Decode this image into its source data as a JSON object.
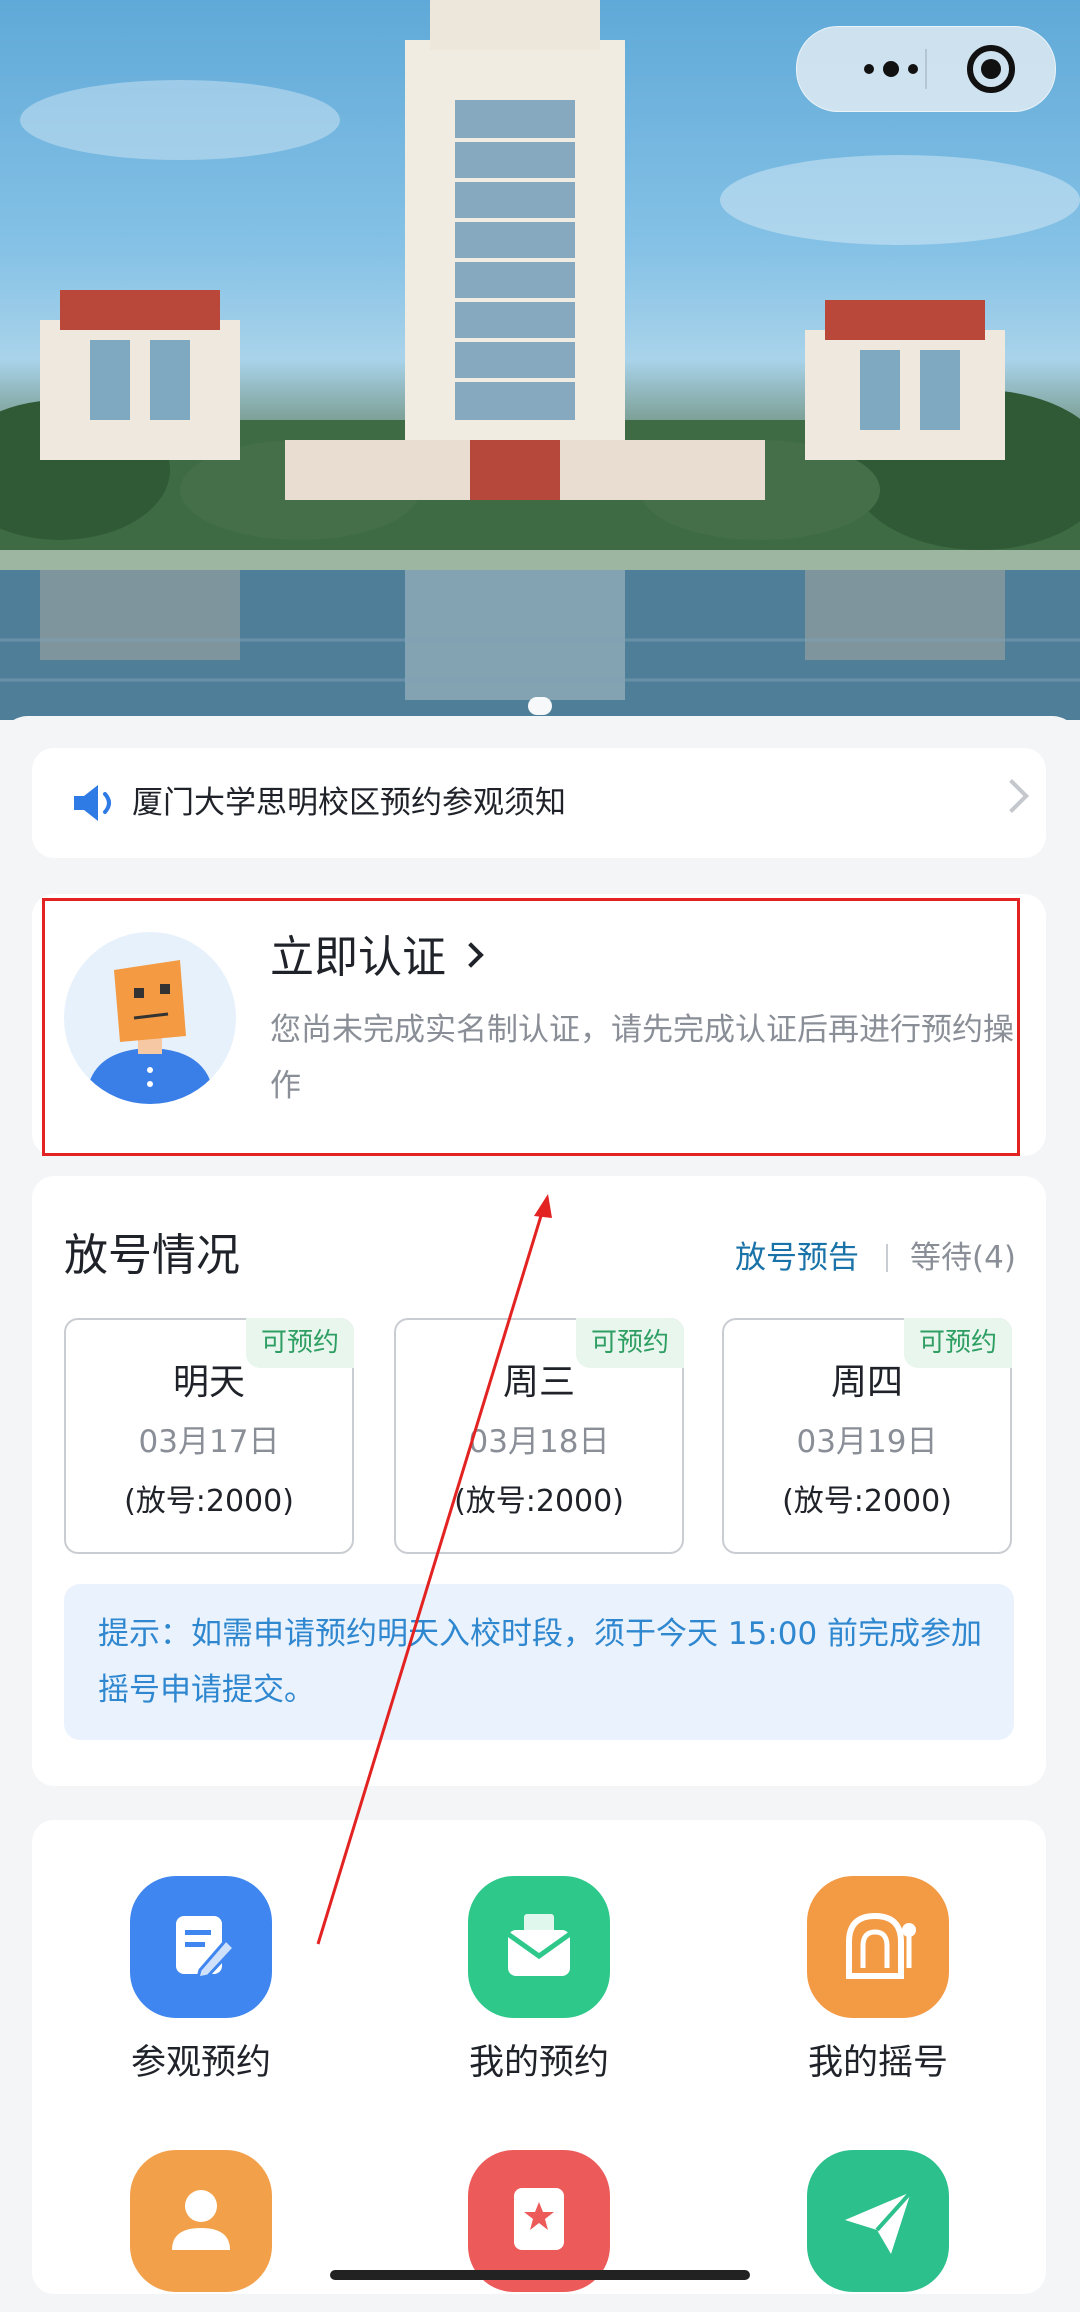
{
  "notice": {
    "text": "厦门大学思明校区预约参观须知"
  },
  "auth": {
    "title": "立即认证",
    "description": "您尚未完成实名制认证，请先完成认证后再进行预约操作"
  },
  "release": {
    "title": "放号情况",
    "preview_link": "放号预告",
    "waiting": "等待(4)",
    "days": [
      {
        "tag": "可预约",
        "name": "明天",
        "date": "03月17日",
        "quota": "(放号:2000)"
      },
      {
        "tag": "可预约",
        "name": "周三",
        "date": "03月18日",
        "quota": "(放号:2000)"
      },
      {
        "tag": "可预约",
        "name": "周四",
        "date": "03月19日",
        "quota": "(放号:2000)"
      }
    ],
    "tip": "提示：如需申请预约明天入校时段，须于今天 15:00 前完成参加摇号申请提交。"
  },
  "menu": {
    "items": [
      {
        "label": "参观预约",
        "icon": "edit-icon",
        "color": "#3f86f0"
      },
      {
        "label": "我的预约",
        "icon": "mail-icon",
        "color": "#2ec98a"
      },
      {
        "label": "我的摇号",
        "icon": "lottery-icon",
        "color": "#f39a45"
      },
      {
        "label": "",
        "icon": "person-icon",
        "color": "#f3a04a"
      },
      {
        "label": "",
        "icon": "document-star-icon",
        "color": "#ec5a5a"
      },
      {
        "label": "",
        "icon": "send-icon",
        "color": "#2bc08c"
      }
    ]
  }
}
